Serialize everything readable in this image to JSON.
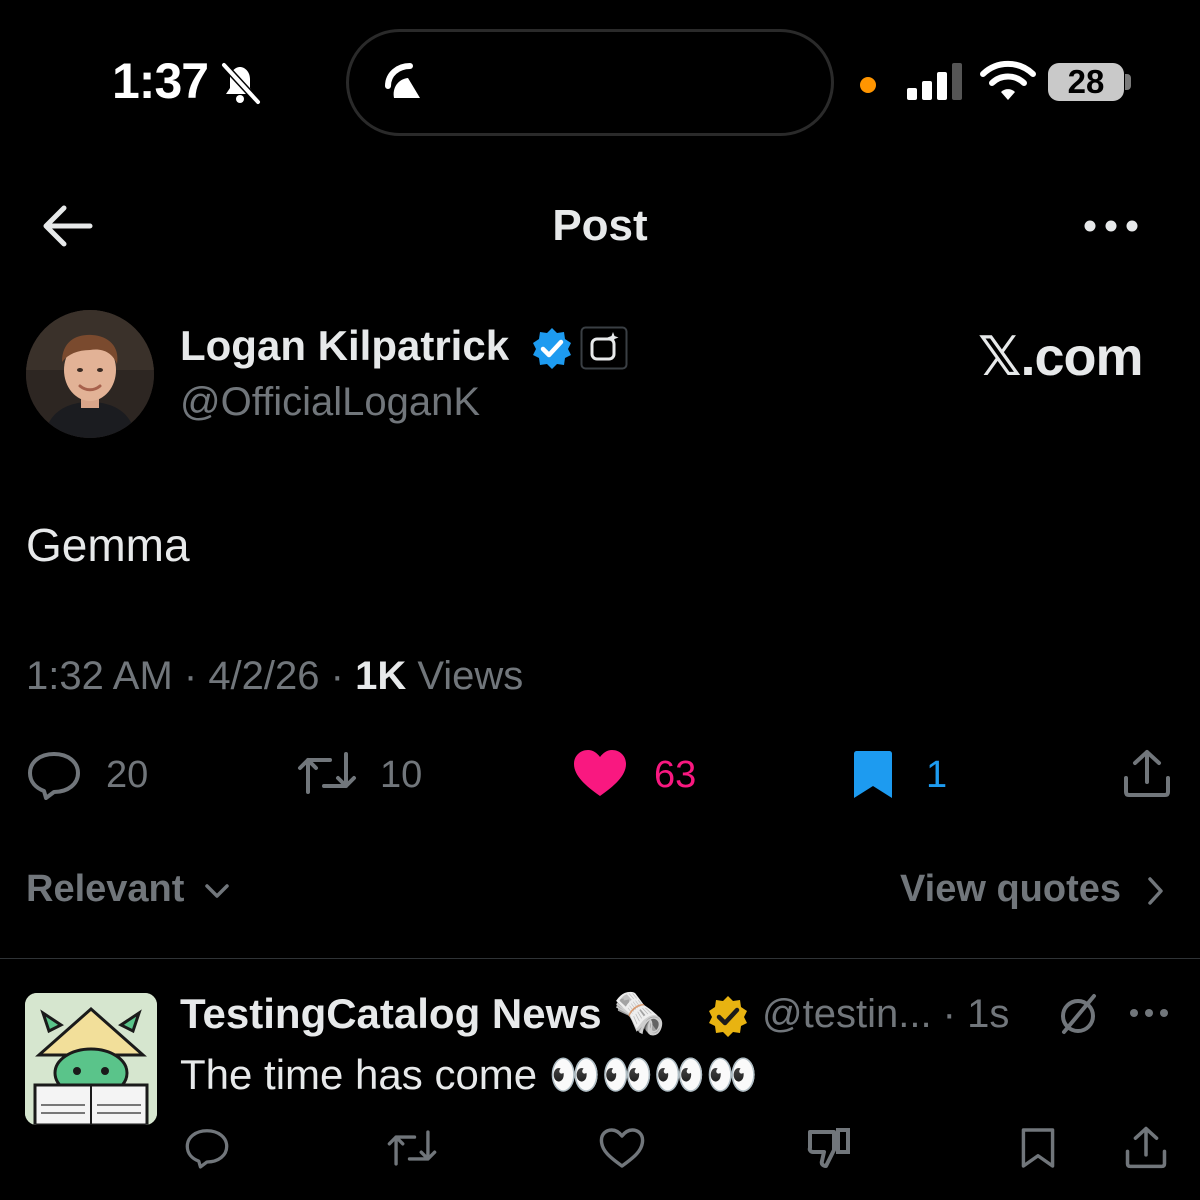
{
  "status_bar": {
    "time": "1:37",
    "battery": "28",
    "icons": [
      "bell-slash-icon",
      "live-activity-icon",
      "cellular-signal-icon",
      "wifi-icon",
      "battery-icon"
    ]
  },
  "header": {
    "title": "Post",
    "back_icon": "arrow-left-icon",
    "more_icon": "ellipsis-icon"
  },
  "post": {
    "author": {
      "name": "Logan Kilpatrick",
      "handle": "@OfficialLoganK",
      "verified_color": "#1d9bf0"
    },
    "watermark": "𝕏.com",
    "text": "Gemma",
    "meta": {
      "time": "1:32 AM",
      "sep1": " · ",
      "date": "4/2/26",
      "sep2": " · ",
      "views_count": "1K",
      "views_label": " Views"
    },
    "actions": {
      "replies": "20",
      "reposts": "10",
      "likes": "63",
      "bookmarks": "1",
      "like_color": "#f91880",
      "bookmark_color": "#1d9bf0"
    }
  },
  "sort": {
    "label": "Relevant",
    "view_quotes": "View quotes"
  },
  "reply": {
    "name": "TestingCatalog News",
    "name_emoji": "🗞️",
    "handle_time": "@testin... · 1s",
    "text": "The time has come 👀👀👀👀",
    "verified_color": "#e8b311"
  },
  "colors": {
    "background": "#000000",
    "text": "#e7e9ea",
    "muted": "#71767b"
  }
}
